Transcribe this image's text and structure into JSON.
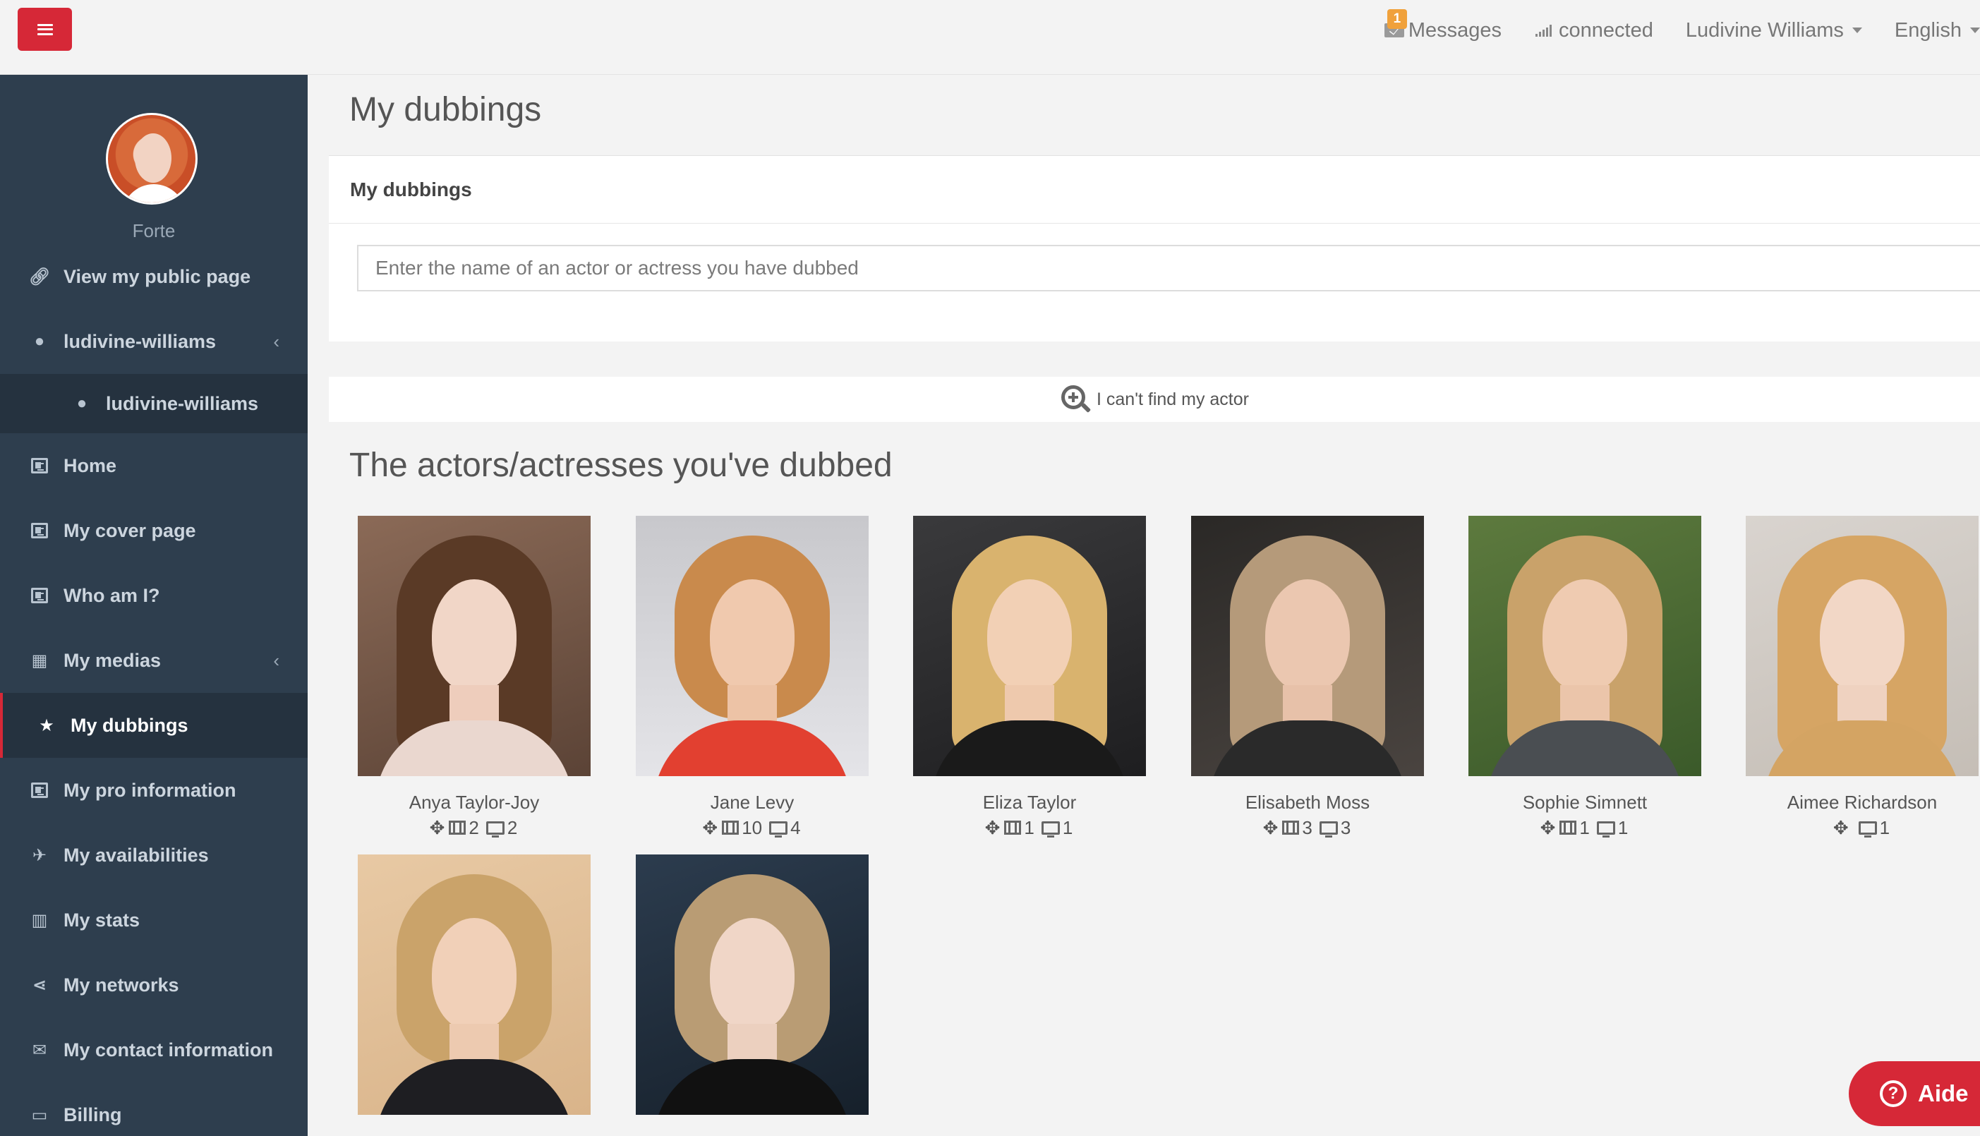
{
  "topbar": {
    "messages_label": "Messages",
    "messages_badge": "1",
    "connection_label": "connected",
    "user_name": "Ludivine Williams",
    "language": "English"
  },
  "sidebar": {
    "role": "Forte",
    "public_page": "View my public page",
    "account_group": "ludivine-williams",
    "account_sub": "ludivine-williams",
    "items": [
      {
        "label": "Home",
        "icon": "id-card-icon"
      },
      {
        "label": "My cover page",
        "icon": "id-card-icon"
      },
      {
        "label": "Who am I?",
        "icon": "id-card-icon"
      },
      {
        "label": "My medias",
        "icon": "grid-icon"
      },
      {
        "label": "My dubbings",
        "icon": "star-icon"
      },
      {
        "label": "My pro information",
        "icon": "id-card-icon"
      },
      {
        "label": "My availabilities",
        "icon": "plane-icon"
      },
      {
        "label": "My stats",
        "icon": "bar-chart-icon"
      },
      {
        "label": "My networks",
        "icon": "share-icon"
      },
      {
        "label": "My contact information",
        "icon": "envelope-icon"
      },
      {
        "label": "Billing",
        "icon": "credit-card-icon"
      }
    ]
  },
  "main": {
    "page_title": "My dubbings",
    "panel_title": "My dubbings",
    "search_placeholder": "Enter the name of an actor or actress you have dubbed",
    "cant_find": "I can't find my actor",
    "section_title": "The actors/actresses you've dubbed",
    "actors": [
      {
        "name": "Anya Taylor-Joy",
        "films": "2",
        "tv": "2"
      },
      {
        "name": "Jane Levy",
        "films": "10",
        "tv": "4"
      },
      {
        "name": "Eliza Taylor",
        "films": "1",
        "tv": "1"
      },
      {
        "name": "Elisabeth Moss",
        "films": "3",
        "tv": "3"
      },
      {
        "name": "Sophie Simnett",
        "films": "1",
        "tv": "1"
      },
      {
        "name": "Aimee Richardson",
        "films": "",
        "tv": "1"
      }
    ]
  },
  "help_button": "Aide",
  "colors": {
    "accent": "#d62837",
    "sidebar": "#2e3e4e",
    "sidebar_active": "#25323f",
    "badge": "#f0a13b"
  }
}
